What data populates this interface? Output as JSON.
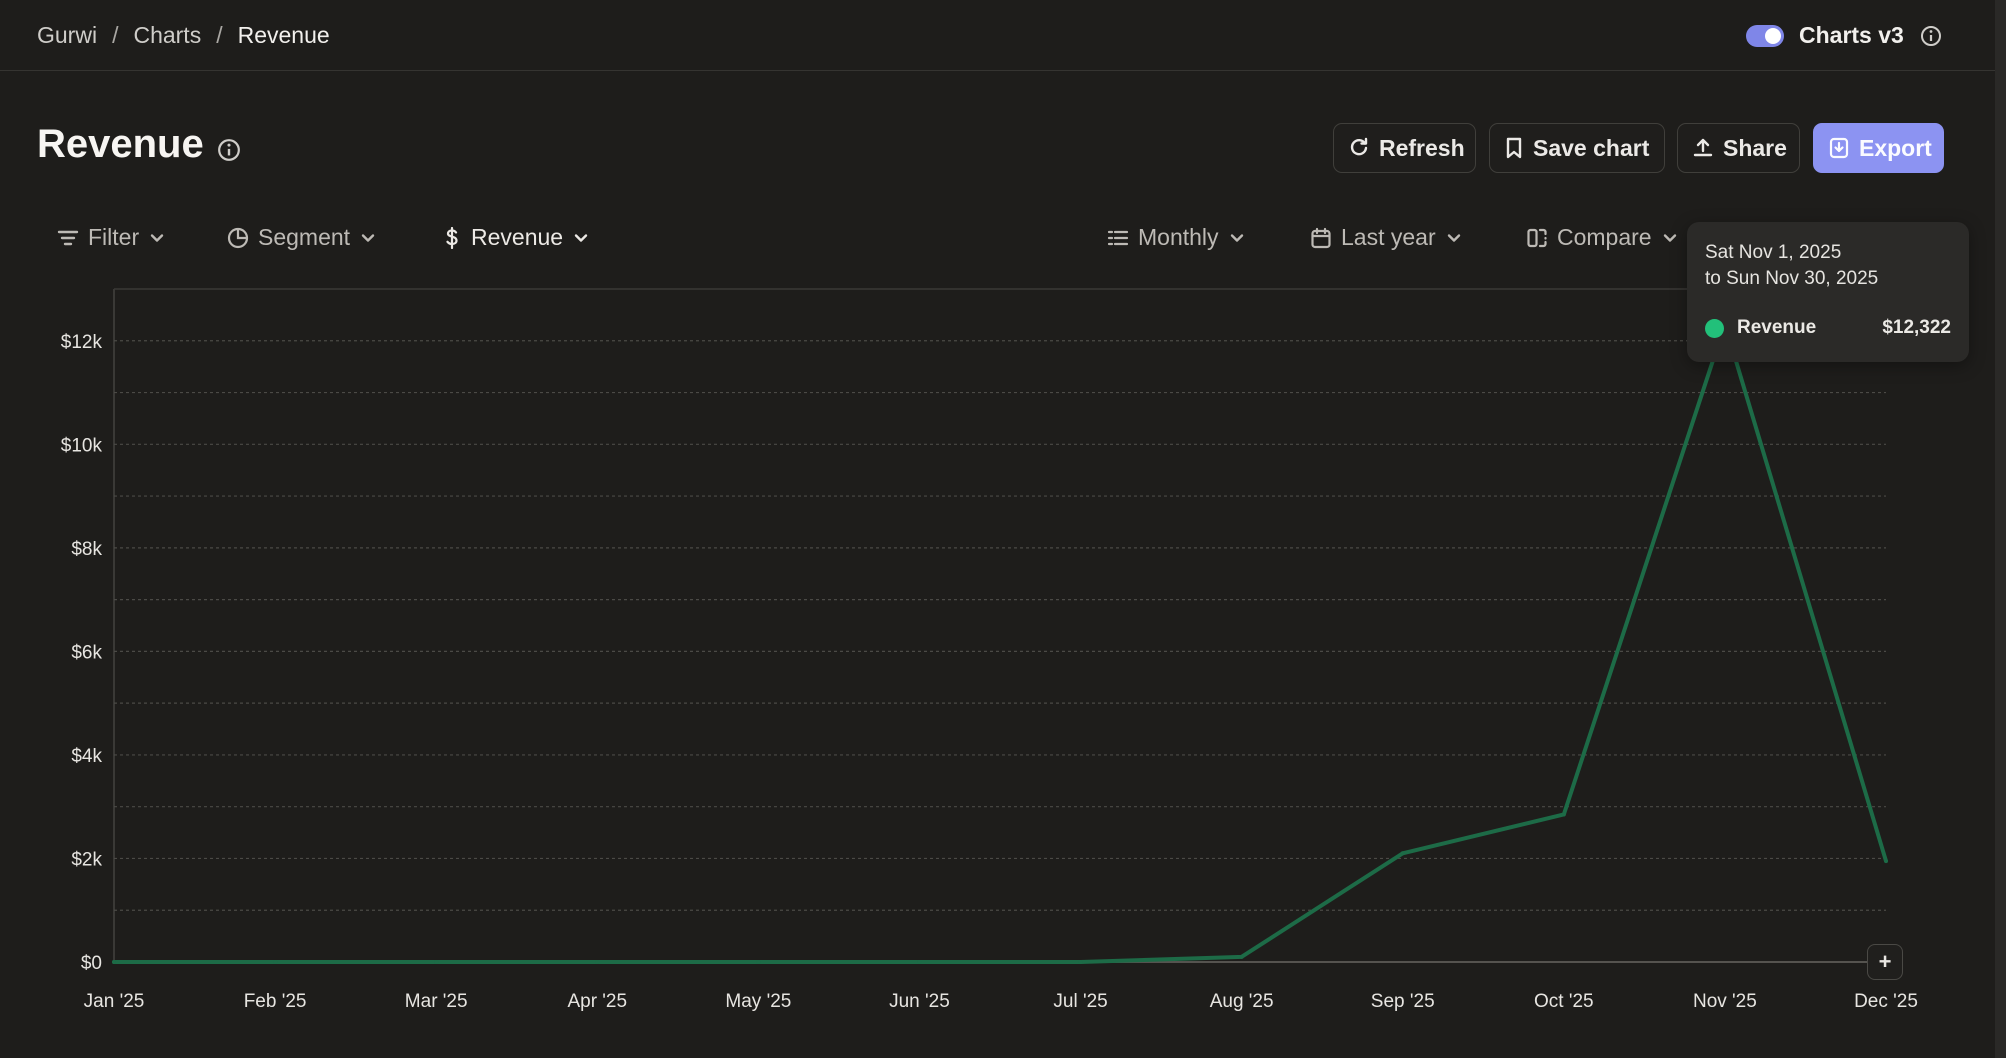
{
  "breadcrumb": {
    "items": [
      "Gurwi",
      "Charts",
      "Revenue"
    ],
    "separator": "/"
  },
  "toggle": {
    "label": "Charts v3",
    "on": true,
    "color": "#7f86e8"
  },
  "header": {
    "title": "Revenue"
  },
  "actions": {
    "refresh_label": "Refresh",
    "save_label": "Save chart",
    "share_label": "Share",
    "export_label": "Export",
    "export_color": "#8c93f2"
  },
  "controls": {
    "filter": "Filter",
    "segment": "Segment",
    "metric": "Revenue",
    "interval": "Monthly",
    "range": "Last year",
    "compare": "Compare"
  },
  "tooltip": {
    "line1": "Sat Nov 1, 2025",
    "line2": "to Sun Nov 30, 2025",
    "series": "Revenue",
    "value": "$12,322",
    "dot_color": "#22c07a"
  },
  "plus_label": "+",
  "chart_data": {
    "type": "line",
    "categories": [
      "Jan '25",
      "Feb '25",
      "Mar '25",
      "Apr '25",
      "May '25",
      "Jun '25",
      "Jul '25",
      "Aug '25",
      "Sep '25",
      "Oct '25",
      "Nov '25",
      "Dec '25"
    ],
    "series": [
      {
        "name": "Revenue",
        "color": "#1d6b47",
        "values": [
          0,
          0,
          0,
          0,
          0,
          0,
          0,
          100,
          2100,
          2850,
          12322,
          1950
        ]
      }
    ],
    "y_ticks": [
      {
        "value": 0,
        "label": "$0"
      },
      {
        "value": 2000,
        "label": "$2k"
      },
      {
        "value": 4000,
        "label": "$4k"
      },
      {
        "value": 6000,
        "label": "$6k"
      },
      {
        "value": 8000,
        "label": "$8k"
      },
      {
        "value": 10000,
        "label": "$10k"
      },
      {
        "value": 12000,
        "label": "$12k"
      }
    ],
    "ylim": [
      0,
      13000
    ],
    "grid_step": 1000,
    "grid": true,
    "highlight_index": 10
  }
}
